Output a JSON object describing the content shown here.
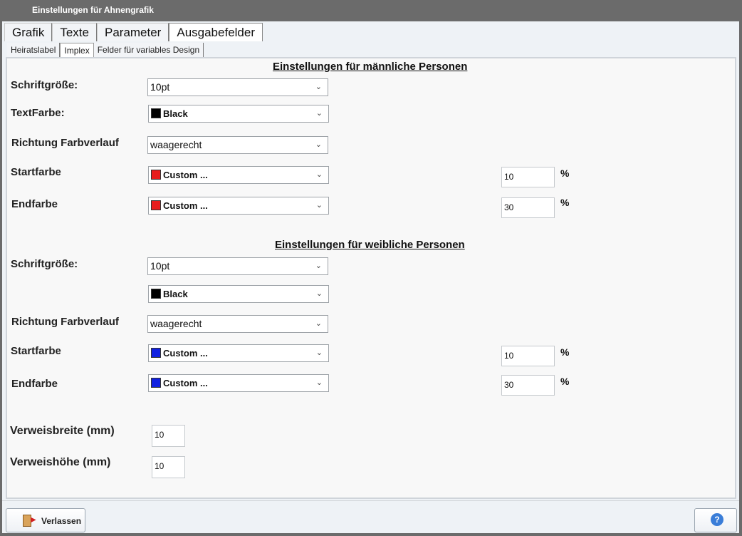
{
  "window": {
    "title": "Einstellungen für Ahnengrafik"
  },
  "tabs_main": [
    "Grafik",
    "Texte",
    "Parameter",
    "Ausgabefelder"
  ],
  "tabs_sub": [
    "Heiratslabel",
    "Implex",
    "Felder für variables Design"
  ],
  "male": {
    "heading": "Einstellungen für männliche Personen",
    "font_size_label": "Schriftgröße:",
    "font_size_value": "10pt",
    "text_color_label": "TextFarbe:",
    "text_color_value": "Black",
    "text_color_swatch": "#000000",
    "gradient_dir_label": "Richtung Farbverlauf",
    "gradient_dir_value": "waagerecht",
    "start_color_label": "Startfarbe",
    "start_color_value": "Custom ...",
    "start_color_swatch": "#e81c1c",
    "start_percent": "10",
    "end_color_label": "Endfarbe",
    "end_color_value": "Custom ...",
    "end_color_swatch": "#e81c1c",
    "end_percent": "30",
    "percent_sign": "%"
  },
  "female": {
    "heading": "Einstellungen für weibliche Personen",
    "font_size_label": "Schriftgröße:",
    "font_size_value": "10pt",
    "text_color_value": "Black",
    "text_color_swatch": "#000000",
    "gradient_dir_label": "Richtung Farbverlauf",
    "gradient_dir_value": "waagerecht",
    "start_color_label": "Startfarbe",
    "start_color_value": "Custom ...",
    "start_color_swatch": "#1020e0",
    "start_percent": "10",
    "end_color_label": "Endfarbe",
    "end_color_value": "Custom ...",
    "end_color_swatch": "#1020e0",
    "end_percent": "30",
    "percent_sign": "%"
  },
  "ref": {
    "width_label": "Verweisbreite (mm)",
    "width_value": "10",
    "height_label": "Verweishöhe (mm)",
    "height_value": "10"
  },
  "footer": {
    "exit_label": "Verlassen",
    "help_icon": "?"
  }
}
